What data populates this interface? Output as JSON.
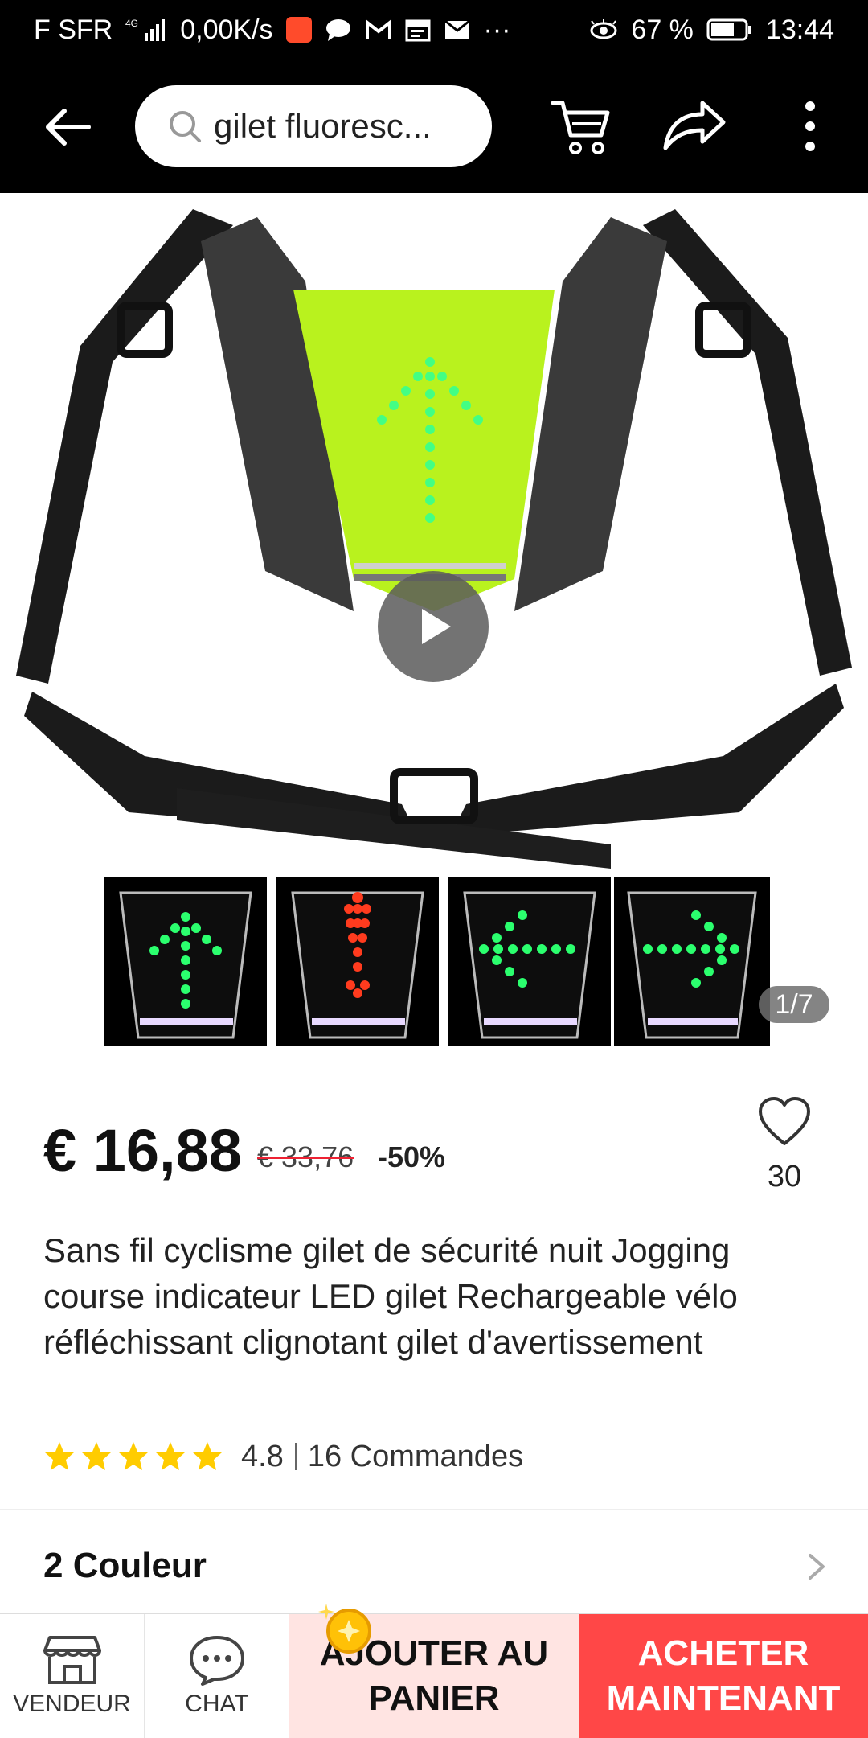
{
  "status_bar": {
    "carrier": "F SFR",
    "network": "4G",
    "speed": "0,00K/s",
    "battery": "67 %",
    "time": "13:44"
  },
  "search": {
    "query": "gilet fluoresc..."
  },
  "gallery": {
    "page_indicator": "1/7"
  },
  "product": {
    "price": "€ 16,88",
    "old_price": "€ 33,76",
    "discount": "-50%",
    "wishlist_count": "30",
    "title": "Sans fil cyclisme gilet de sécurité nuit Jogging course indicateur LED gilet Rechargeable vélo réfléchissant clignotant gilet d'avertissement",
    "rating": "4.8",
    "orders": "16 Commandes",
    "colors_label": "2 Couleur"
  },
  "bottom_bar": {
    "vendor_label": "VENDEUR",
    "chat_label": "CHAT",
    "add_to_cart_label": "AJOUTER AU PANIER",
    "buy_now_label": "ACHETER MAINTENANT"
  },
  "colors": {
    "accent_red": "#ff4747",
    "add_bg": "#ffe4e2",
    "star": "#ffcc00"
  }
}
